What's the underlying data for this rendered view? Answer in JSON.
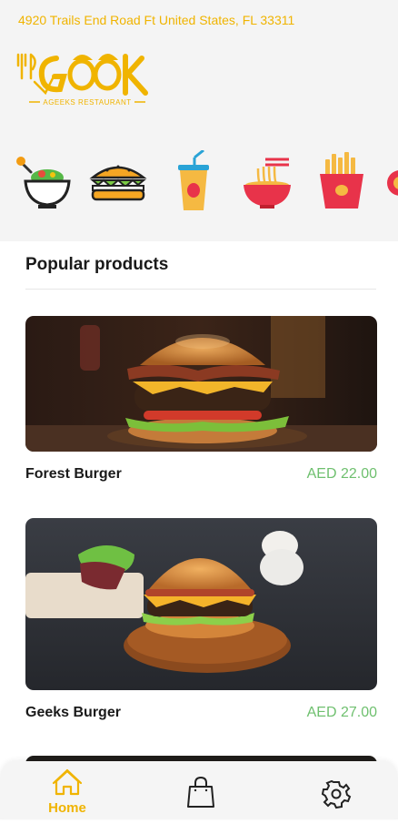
{
  "header": {
    "address": "4920 Trails End Road Ft United States, FL 33311",
    "logo_text": "GEEKS",
    "logo_subtitle": "AGEEKS RESTAURANT"
  },
  "categories": [
    {
      "icon": "salad-bowl-icon"
    },
    {
      "icon": "sandwich-icon"
    },
    {
      "icon": "drink-cup-icon"
    },
    {
      "icon": "noodles-bowl-icon"
    },
    {
      "icon": "french-fries-icon"
    },
    {
      "icon": "more-category-icon"
    }
  ],
  "section": {
    "title": "Popular products"
  },
  "products": [
    {
      "name": "Forest Burger",
      "price": "AED 22.00",
      "image": "burger-photo"
    },
    {
      "name": "Geeks Burger",
      "price": "AED 27.00",
      "image": "burger-photo"
    }
  ],
  "nav": {
    "items": [
      {
        "label": "Home",
        "icon": "home-icon",
        "active": true
      },
      {
        "label": "",
        "icon": "shopping-bag-icon",
        "active": false
      },
      {
        "label": "",
        "icon": "settings-gear-icon",
        "active": false
      }
    ]
  },
  "colors": {
    "accent": "#f0b400",
    "price": "#6fc06f",
    "header_bg": "#f4f4f4"
  }
}
